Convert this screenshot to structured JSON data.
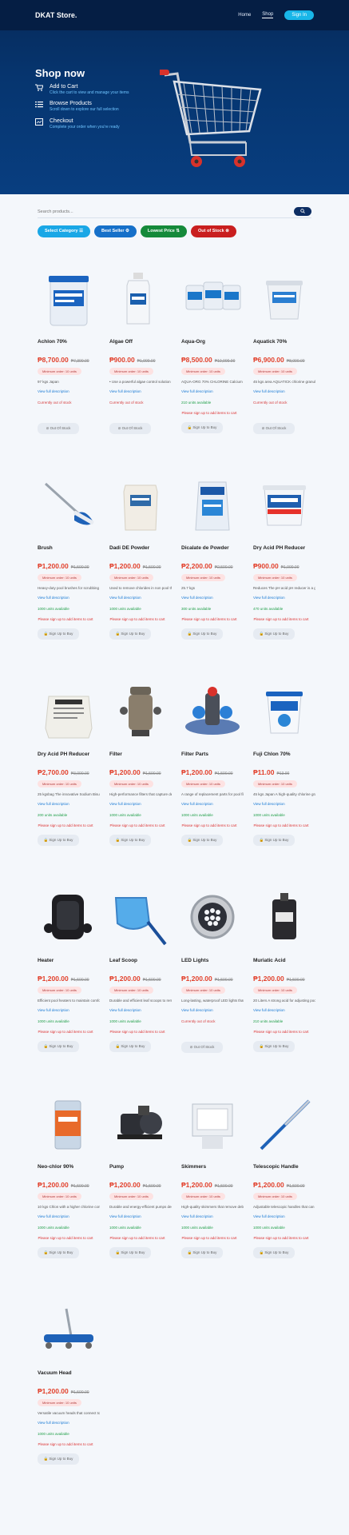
{
  "nav": {
    "brand": "DKAT Store.",
    "links": [
      "Home",
      "Shop"
    ],
    "signin": "Sign In"
  },
  "hero": {
    "title": "Shop now",
    "features": [
      {
        "icon": "cart-icon",
        "title": "Add to Cart",
        "subtitle": "Click the cart to view and manage your items"
      },
      {
        "icon": "list-icon",
        "title": "Browse Products",
        "subtitle": "Scroll down to explore our full selection"
      },
      {
        "icon": "checkout-icon",
        "title": "Checkout",
        "subtitle": "Complete your order when you're ready"
      }
    ]
  },
  "search": {
    "placeholder": "Search products..."
  },
  "filters": [
    {
      "label": "Select Category ☰",
      "color": "#1aa7e6"
    },
    {
      "label": "Best Seller ⚙",
      "color": "#1670c9"
    },
    {
      "label": "Lowest Price ⇅",
      "color": "#158a3a"
    },
    {
      "label": "Out of Stock ⊗",
      "color": "#c91f1f"
    }
  ],
  "labels": {
    "min_order": "Minimum order: 10 units",
    "view_desc": "View full description",
    "out_of_stock": "Currently out of stock",
    "please_sign": "Please sign up to add items to cart",
    "cta_out": "⊘ Out Of Stock",
    "cta_sign": "🔒 Sign Up to Buy"
  },
  "products": [
    {
      "name": "Achlon 70%",
      "price": "₱8,700.00",
      "old": "₱7,300.00",
      "desc": "97 kgs Japan",
      "stock": "",
      "status": "out",
      "img": "bucket"
    },
    {
      "name": "Algae Off",
      "price": "₱900.00",
      "old": "₱1,000.00",
      "desc": "• Use a powerful algae control solution that keeps your pool",
      "stock": "",
      "status": "out",
      "img": "bottle"
    },
    {
      "name": "Aqua-Org",
      "price": "₱8,500.00",
      "old": "₱10,000.00",
      "desc": "AQUA-ORG 70% CHLORINE Calcium Made from Indo-US",
      "stock": "210 units available",
      "status": "in",
      "img": "tubs"
    },
    {
      "name": "Aquatick 70%",
      "price": "₱6,900.00",
      "old": "₱8,000.00",
      "desc": "45 kgs area AQUATICK chlorine granules granule effective",
      "stock": "",
      "status": "out",
      "img": "pail"
    },
    {
      "name": "Brush",
      "price": "₱1,200.00",
      "old": "₱1,500.00",
      "desc": "Heavy-duty pool brushes for scrubbing and cleaning pool",
      "stock": "1000 units available",
      "status": "in",
      "img": "brush"
    },
    {
      "name": "Dadi DE Powder",
      "price": "₱1,200.00",
      "old": "₱1,500.00",
      "desc": "Used to remove chlorides in non pool through filtration DE",
      "stock": "1000 units available",
      "status": "in",
      "img": "sack"
    },
    {
      "name": "Dicalate de Powder",
      "price": "₱2,200.00",
      "old": "₱2,500.00",
      "desc": "25.7 kgs",
      "stock": "300 units available",
      "status": "in",
      "img": "bag"
    },
    {
      "name": "Dry Acid PH Reducer",
      "price": "₱900.00",
      "old": "₱1,000.00",
      "desc": "Reduces The pH acid pH reducer is a granular compound",
      "stock": "470 units available",
      "status": "in",
      "img": "pail2"
    },
    {
      "name": "Dry Acid PH Reducer",
      "price": "₱2,700.00",
      "old": "₱3,000.00",
      "desc": "25 kgsbag The innovative Sodium Bisulfate, in a 25kg bag",
      "stock": "200 units available",
      "status": "in",
      "img": "sack2"
    },
    {
      "name": "Filter",
      "price": "₱1,200.00",
      "old": "₱1,500.00",
      "desc": "High-performance filters that capture debris and fine particles",
      "stock": "1000 units available",
      "status": "in",
      "img": "filter"
    },
    {
      "name": "Filter Parts",
      "price": "₱1,200.00",
      "old": "₱1,500.00",
      "desc": "A range of replacement parts for pool filters including cartridges",
      "stock": "1000 units available",
      "status": "in",
      "img": "parts"
    },
    {
      "name": "Fuji Chlon 70%",
      "price": "₱11.00",
      "old": "₱13.00",
      "desc": "45 kgs Japan A high-quality chlorine granule from Japan",
      "stock": "1000 units available",
      "status": "in",
      "img": "pail3"
    },
    {
      "name": "Heater",
      "price": "₱1,200.00",
      "old": "₱1,500.00",
      "desc": "Efficient pool heaters to maintain comfortable water temperature",
      "stock": "1000 units available",
      "status": "in",
      "img": "heater"
    },
    {
      "name": "Leaf Scoop",
      "price": "₱1,200.00",
      "old": "₱1,500.00",
      "desc": "Durable and efficient leaf scoops to remove leaves and larger debris",
      "stock": "1000 units available",
      "status": "in",
      "img": "scoop"
    },
    {
      "name": "LED Lights",
      "price": "₱1,200.00",
      "old": "₱1,500.00",
      "desc": "Long-lasting, waterproof LED lights that illuminate your pool",
      "stock": "",
      "status": "out",
      "img": "led"
    },
    {
      "name": "Muriatic Acid",
      "price": "₱1,200.00",
      "old": "₱1,500.00",
      "desc": "20 Liters A strong acid for adjusting pool pH and alkalinity",
      "stock": "210 units available",
      "status": "in",
      "img": "jug"
    },
    {
      "name": "Neo-chlor 90%",
      "price": "₱1,200.00",
      "old": "₱1,500.00",
      "desc": "10 kgs Chlon with a higher chlorine concentration, NEO-",
      "stock": "1000 units available",
      "status": "in",
      "img": "canister"
    },
    {
      "name": "Pump",
      "price": "₱1,200.00",
      "old": "₱1,500.00",
      "desc": "Durable and energy-efficient pumps designed to keep your",
      "stock": "1000 units available",
      "status": "in",
      "img": "pump"
    },
    {
      "name": "Skimmers",
      "price": "₱1,200.00",
      "old": "₱1,500.00",
      "desc": "High-quality skimmers that remove debris from the water",
      "stock": "1000 units available",
      "status": "in",
      "img": "skimmer"
    },
    {
      "name": "Telescopic Handle",
      "price": "₱1,200.00",
      "old": "₱1,500.00",
      "desc": "Adjustable telescopic handles that can be used with various",
      "stock": "1000 units available",
      "status": "in",
      "img": "pole"
    },
    {
      "name": "Vacuum Head",
      "price": "₱1,200.00",
      "old": "₱1,500.00",
      "desc": "Versatile vacuum heads that connect to your pool's filtration",
      "stock": "1000 units available",
      "status": "in",
      "img": "vac"
    }
  ]
}
